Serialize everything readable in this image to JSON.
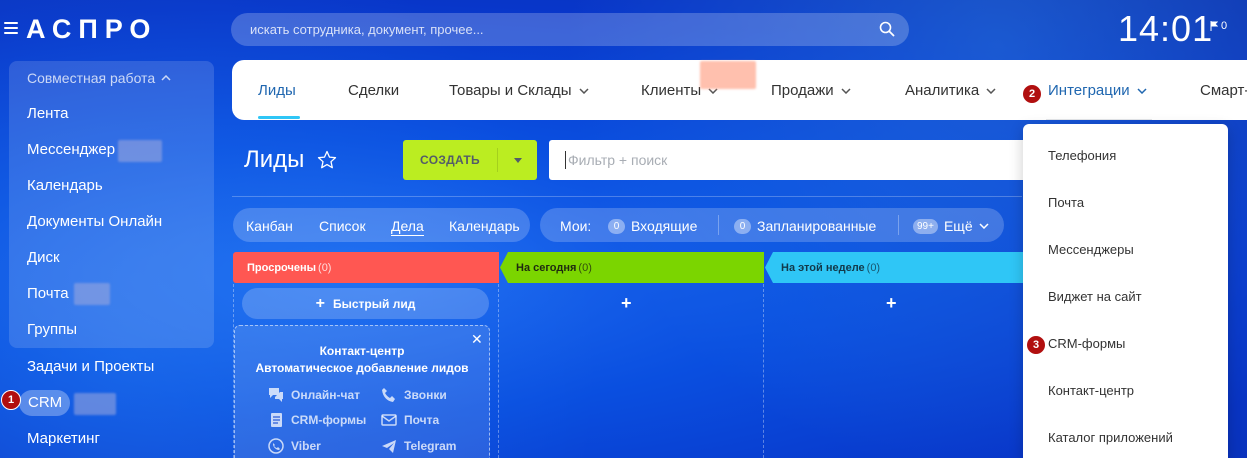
{
  "header": {
    "logo": "АСПРО",
    "search_placeholder": "искать сотрудника, документ, прочее...",
    "clock": "14:01",
    "flag_count": "0"
  },
  "sidebar": {
    "group_title": "Совместная работа",
    "items": [
      "Лента",
      "Мессенджер",
      "Календарь",
      "Документы Онлайн",
      "Диск",
      "Почта",
      "Группы"
    ],
    "after_items": [
      "Задачи и Проекты",
      "CRM",
      "Маркетинг"
    ]
  },
  "topnav": {
    "items": [
      "Лиды",
      "Сделки",
      "Товары и Склады",
      "Клиенты",
      "Продажи",
      "Аналитика",
      "Интеграции",
      "Смарт-"
    ]
  },
  "page": {
    "title": "Лиды",
    "create_label": "СОЗДАТЬ",
    "filter_placeholder": "Фильтр + поиск"
  },
  "view_tabs": [
    "Канбан",
    "Список",
    "Дела",
    "Календарь"
  ],
  "my_tabs": {
    "label": "Мои:",
    "incoming_count": "0",
    "incoming": "Входящие",
    "planned_count": "0",
    "planned": "Запланированные",
    "more_count": "99+",
    "more": "Ещё"
  },
  "columns": [
    {
      "title": "Просрочены",
      "count": "(0)",
      "color": "#ff5752"
    },
    {
      "title": "На сегодня",
      "count": "(0)",
      "color": "#7bd500"
    },
    {
      "title": "На этой неделе",
      "count": "(0)",
      "color": "#2fc6f6"
    }
  ],
  "quick_lead": "Быстрый лид",
  "contact_center": {
    "title": "Контакт-центр",
    "subtitle": "Автоматическое добавление лидов",
    "items": [
      "Онлайн-чат",
      "Звонки",
      "CRM-формы",
      "Почта",
      "Viber",
      "Telegram"
    ]
  },
  "dropdown": {
    "items": [
      "Телефония",
      "Почта",
      "Мессенджеры",
      "Виджет на сайт",
      "CRM-формы",
      "Контакт-центр",
      "Каталог приложений"
    ]
  },
  "badges": [
    "1",
    "2",
    "3"
  ],
  "icons": [
    "menu-icon",
    "search-icon",
    "flag-icon",
    "star-icon",
    "chevron-down-icon",
    "plus-icon",
    "close-icon",
    "chat-icon",
    "phone-icon",
    "form-icon",
    "mail-icon",
    "viber-icon",
    "telegram-icon"
  ]
}
